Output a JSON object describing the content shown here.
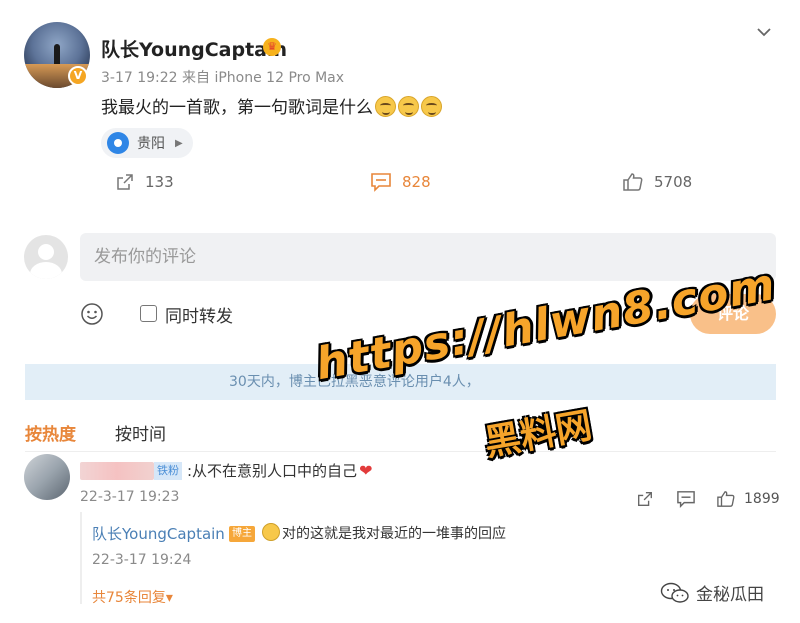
{
  "post": {
    "username": "队长YoungCaptain",
    "meta": "3-17 19:22  来自 iPhone 12 Pro Max",
    "content": "我最火的一首歌，第一句歌词是什么",
    "location": "贵阳",
    "shares": "133",
    "comments": "828",
    "likes": "5708"
  },
  "compose": {
    "placeholder": "发布你的评论",
    "repost_label": "同时转发",
    "submit_label": "评论"
  },
  "notice": "30天内，博主已拉黑恶意评论用户4人，",
  "tabs": {
    "hot": "按热度",
    "time": "按时间"
  },
  "comment": {
    "badge": "铁粉",
    "text": ":从不在意别人口中的自己",
    "time": "22-3-17 19:23",
    "likes": "1899"
  },
  "reply": {
    "username": "队长YoungCaptain",
    "badge": "博主",
    "text": "对的这就是我对最近的一堆事的回应",
    "time": "22-3-17 19:24",
    "more": "共75条回复"
  },
  "watermark": {
    "url": "https://hlwn8.com",
    "site": "黑料网",
    "brand": "金秘瓜田"
  },
  "colors": {
    "accent": "#e8863a",
    "link": "#4a7fb5",
    "notice_bg": "#e2eef7"
  }
}
